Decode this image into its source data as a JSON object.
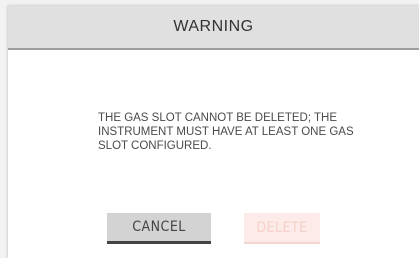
{
  "dialog": {
    "title": "WARNING",
    "message": "THE GAS SLOT CANNOT BE DELETED; THE INSTRUMENT MUST HAVE AT LEAST ONE GAS SLOT CONFIGURED.",
    "cancel_label": "CANCEL",
    "delete_label": "DELETE",
    "delete_enabled": false
  },
  "colors": {
    "header_bg": "#e0e0e0",
    "header_border": "#9e9e9e",
    "cancel_bg": "#d3d3d3",
    "cancel_underline": "#444444",
    "delete_disabled_bg": "#fcebe8",
    "delete_disabled_text": "#f6d0c9"
  }
}
